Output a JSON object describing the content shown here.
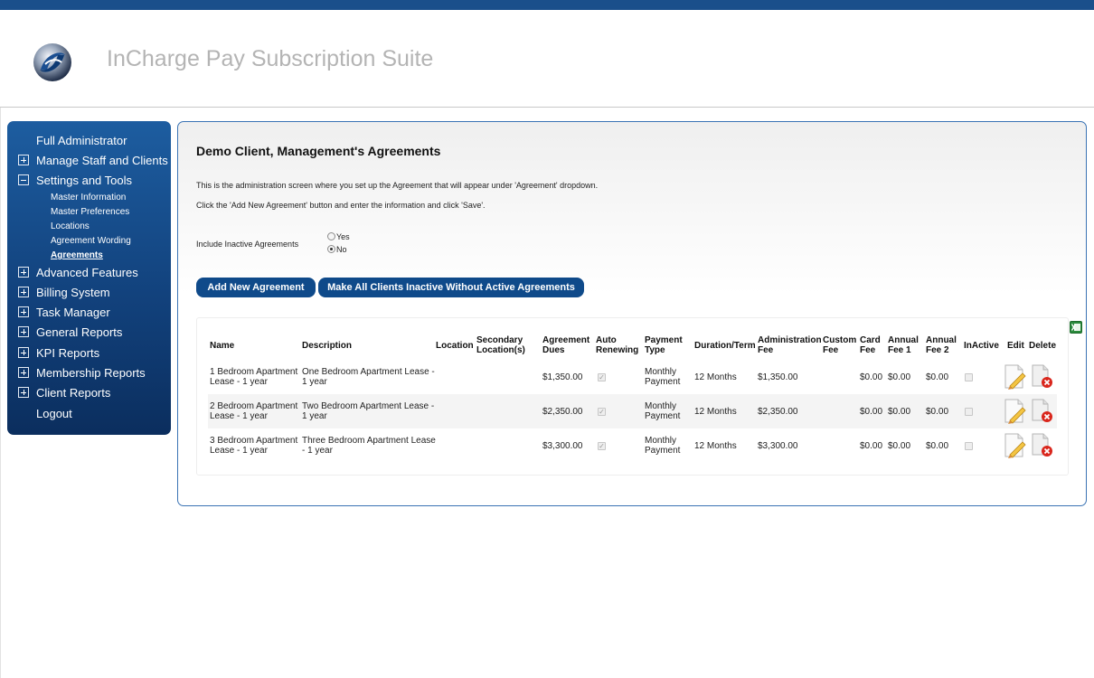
{
  "app": {
    "title": "InCharge Pay Subscription Suite"
  },
  "sidebar": {
    "items": [
      {
        "label": "Full Administrator",
        "icon": "none"
      },
      {
        "label": "Manage Staff and Clients",
        "icon": "plus-icon"
      },
      {
        "label": "Settings and Tools",
        "icon": "minus-icon"
      },
      {
        "label": "Advanced Features",
        "icon": "plus-icon"
      },
      {
        "label": "Billing System",
        "icon": "plus-icon"
      },
      {
        "label": "Task Manager",
        "icon": "plus-icon"
      },
      {
        "label": "General Reports",
        "icon": "plus-icon"
      },
      {
        "label": "KPI Reports",
        "icon": "plus-icon"
      },
      {
        "label": "Membership Reports",
        "icon": "plus-icon"
      },
      {
        "label": "Client Reports",
        "icon": "plus-icon"
      },
      {
        "label": "Logout",
        "icon": "none"
      }
    ],
    "subitems": [
      "Master Information",
      "Master Preferences",
      "Locations",
      "Agreement Wording",
      "Agreements"
    ],
    "active_subitem": "Agreements"
  },
  "main": {
    "title": "Demo Client, Management's Agreements",
    "desc1": "This is the administration screen where you set up the Agreement that will appear under 'Agreement' dropdown.",
    "desc2": "Click the 'Add New Agreement' button and enter the information and click 'Save'.",
    "include_inactive_label": "Include Inactive Agreements",
    "radio_yes": "Yes",
    "radio_no": "No",
    "radio_selected": "No",
    "add_button": "Add New Agreement",
    "inactive_button": "Make All Clients Inactive Without Active Agreements"
  },
  "table": {
    "headers": {
      "name": "Name",
      "description": "Description",
      "location": "Location",
      "secondary_1": "Secondary",
      "secondary_2": "Location(s)",
      "dues_1": "Agreement",
      "dues_2": "Dues",
      "auto_1": "Auto",
      "auto_2": "Renewing",
      "payment_1": "Payment",
      "payment_2": "Type",
      "duration": "Duration/Term",
      "admin_1": "Administration",
      "admin_2": "Fee",
      "custom_1": "Custom",
      "custom_2": "Fee",
      "card_1": "Card",
      "card_2": "Fee",
      "annual1_1": "Annual",
      "annual1_2": "Fee 1",
      "annual2_1": "Annual",
      "annual2_2": "Fee 2",
      "inactive": "InActive",
      "edit": "Edit",
      "delete": "Delete"
    },
    "rows": [
      {
        "name_1": "1 Bedroom Apartment",
        "name_2": "Lease - 1 year",
        "desc_1": "One Bedroom Apartment Lease -",
        "desc_2": "1 year",
        "dues": "$1,350.00",
        "auto_renewing": true,
        "pay_1": "Monthly",
        "pay_2": "Payment",
        "duration": "12 Months",
        "admin_fee": "$1,350.00",
        "card_fee": "$0.00",
        "annual_fee_1": "$0.00",
        "annual_fee_2": "$0.00",
        "inactive": false
      },
      {
        "name_1": "2 Bedroom Apartment",
        "name_2": "Lease - 1 year",
        "desc_1": "Two Bedroom Apartment Lease -",
        "desc_2": "1 year",
        "dues": "$2,350.00",
        "auto_renewing": true,
        "pay_1": "Monthly",
        "pay_2": "Payment",
        "duration": "12 Months",
        "admin_fee": "$2,350.00",
        "card_fee": "$0.00",
        "annual_fee_1": "$0.00",
        "annual_fee_2": "$0.00",
        "inactive": false
      },
      {
        "name_1": "3 Bedroom Apartment",
        "name_2": "Lease - 1 year",
        "desc_1": "Three Bedroom Apartment Lease",
        "desc_2": "- 1 year",
        "dues": "$3,300.00",
        "auto_renewing": true,
        "pay_1": "Monthly",
        "pay_2": "Payment",
        "duration": "12 Months",
        "admin_fee": "$3,300.00",
        "card_fee": "$0.00",
        "annual_fee_1": "$0.00",
        "annual_fee_2": "$0.00",
        "inactive": false
      }
    ]
  },
  "colors": {
    "brand_blue": "#1a4f8b",
    "button_blue": "#0f4a8a",
    "panel_border": "#3a73b4"
  }
}
